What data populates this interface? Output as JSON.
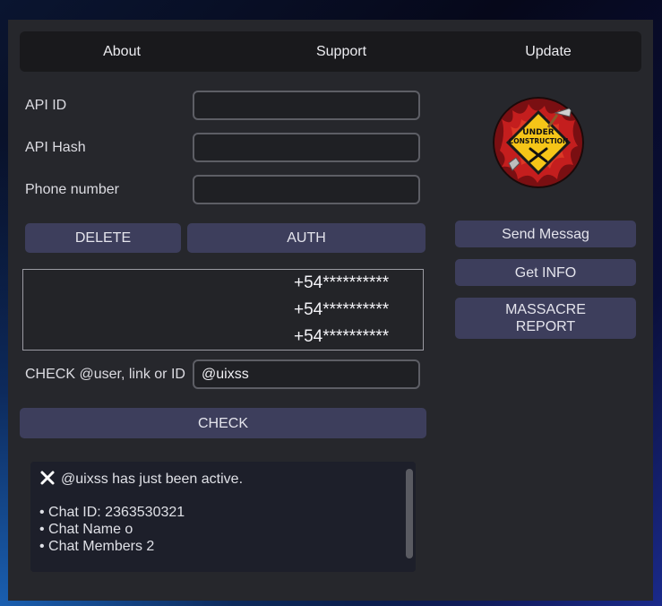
{
  "menu": {
    "about": "About",
    "support": "Support",
    "update": "Update"
  },
  "form": {
    "api_id_label": "API ID",
    "api_id_value": "",
    "api_hash_label": "API Hash",
    "api_hash_value": "",
    "phone_label": "Phone number",
    "phone_value": ""
  },
  "buttons": {
    "delete": "DELETE",
    "auth": "AUTH",
    "check": "CHECK",
    "send_message": "Send Messag",
    "get_info": "Get INFO",
    "massacre_line1": "MASSACRE",
    "massacre_line2": "REPORT"
  },
  "phone_numbers": [
    "+54**********",
    "+54**********",
    "+54**********"
  ],
  "check": {
    "label": "CHECK @user, link or ID",
    "value": "@uixss"
  },
  "result": {
    "status_icon": "close-x-icon",
    "status": "@uixss has just been active.",
    "chat_id": "• Chat ID: 2363530321",
    "chat_name": "• Chat Name o",
    "chat_members": "• Chat Members 2"
  },
  "logo": {
    "line1": "UNDER",
    "line2": "CONSTRUCTION"
  },
  "colors": {
    "button_bg": "#3d3e5c",
    "panel_bg": "#26272c",
    "menubar_bg": "#19191c",
    "logo_sign": "#f5c518",
    "logo_fire": "#c41e1e"
  }
}
